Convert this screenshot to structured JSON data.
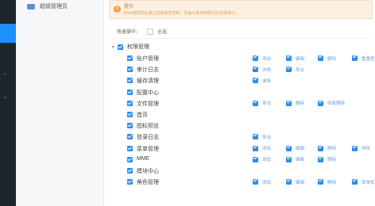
{
  "sidebar": {
    "items": [
      {
        "label": "超级管理员"
      }
    ]
  },
  "notice": {
    "icon": "!",
    "title": "提示",
    "text": "Web端权限是通过前端组件控制，页面元素级权限对应后端接口，..."
  },
  "quick_actions": {
    "label": "快速操作：",
    "select_all_label": "全选"
  },
  "permission_tree": {
    "root": {
      "label": "权限管理",
      "expanded": true
    },
    "modules": [
      {
        "label": "账户管理",
        "permissions": [
          "添加",
          "编辑",
          "删除",
          "重置密码"
        ]
      },
      {
        "label": "审计日志",
        "permissions": [
          "详情",
          "导出"
        ]
      },
      {
        "label": "缓存清理",
        "permissions": [
          "清除"
        ]
      },
      {
        "label": "配置中心",
        "permissions": []
      },
      {
        "label": "文件管理",
        "permissions": [
          "导出",
          "删除",
          "彻底删除"
        ]
      },
      {
        "label": "首页",
        "permissions": []
      },
      {
        "label": "图标预览",
        "permissions": []
      },
      {
        "label": "登录日志",
        "permissions": [
          "导出"
        ]
      },
      {
        "label": "菜单管理",
        "permissions": [
          "添加",
          "编辑",
          "删除",
          "排序"
        ]
      },
      {
        "label": "MME",
        "permissions": [
          "添加",
          "编辑",
          "删除"
        ]
      },
      {
        "label": "模块中心",
        "permissions": []
      },
      {
        "label": "角色管理",
        "permissions": [
          "添加",
          "编辑",
          "删除",
          "菜单权限"
        ]
      }
    ]
  },
  "colors": {
    "checkbox": "#2d8cf0",
    "accent": "#1e90ff",
    "warning": "#f0a24a"
  }
}
